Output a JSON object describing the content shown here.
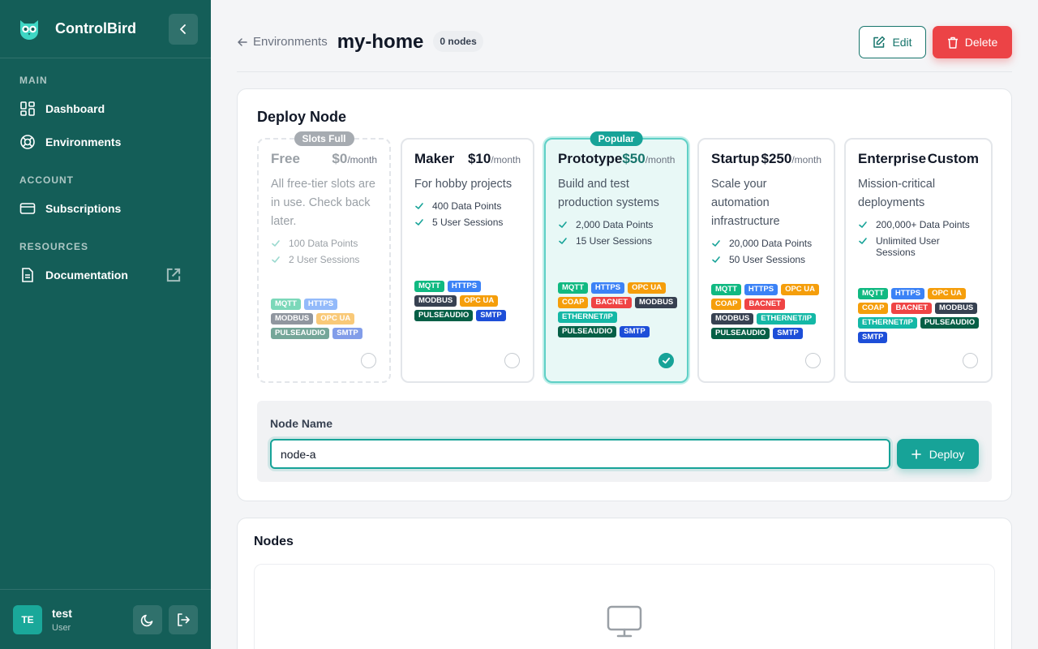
{
  "app": {
    "name": "ControlBird"
  },
  "sidebar": {
    "sections": [
      {
        "heading": "MAIN",
        "items": [
          {
            "label": "Dashboard",
            "icon": "dashboard-icon"
          },
          {
            "label": "Environments",
            "icon": "lifebuoy-icon"
          }
        ]
      },
      {
        "heading": "ACCOUNT",
        "items": [
          {
            "label": "Subscriptions",
            "icon": "credit-card-icon"
          }
        ]
      },
      {
        "heading": "RESOURCES",
        "items": [
          {
            "label": "Documentation",
            "icon": "document-icon"
          }
        ]
      }
    ],
    "user": {
      "initials": "TE",
      "name": "test",
      "role": "User"
    }
  },
  "header": {
    "back_label": "Environments",
    "title": "my-home",
    "node_count": "0 nodes",
    "edit_label": "Edit",
    "delete_label": "Delete"
  },
  "deploy": {
    "title": "Deploy Node",
    "plans": [
      {
        "name": "Free",
        "price": "$0",
        "period": "/month",
        "desc": "All free-tier slots are in use. Check back later.",
        "features": [
          "100 Data Points",
          "2 User Sessions"
        ],
        "badge": "Slots Full",
        "state": "disabled",
        "tags": [
          {
            "t": "MQTT",
            "c": "#10b981"
          },
          {
            "t": "HTTPS",
            "c": "#3b82f6"
          },
          {
            "t": "MODBUS",
            "c": "#374151"
          },
          {
            "t": "OPC UA",
            "c": "#f59e0b"
          },
          {
            "t": "PULSEAUDIO",
            "c": "#065f46"
          },
          {
            "t": "SMTP",
            "c": "#1d4ed8"
          }
        ]
      },
      {
        "name": "Maker",
        "price": "$10",
        "period": "/month",
        "desc": "For hobby projects",
        "features": [
          "400 Data Points",
          "5 User Sessions"
        ],
        "badge": "",
        "state": "normal",
        "tags": [
          {
            "t": "MQTT",
            "c": "#10b981"
          },
          {
            "t": "HTTPS",
            "c": "#3b82f6"
          },
          {
            "t": "MODBUS",
            "c": "#374151"
          },
          {
            "t": "OPC UA",
            "c": "#f59e0b"
          },
          {
            "t": "PULSEAUDIO",
            "c": "#065f46"
          },
          {
            "t": "SMTP",
            "c": "#1d4ed8"
          }
        ]
      },
      {
        "name": "Prototype",
        "price": "$50",
        "period": "/month",
        "desc": "Build and test production systems",
        "features": [
          "2,000 Data Points",
          "15 User Sessions"
        ],
        "badge": "Popular",
        "state": "selected",
        "tags": [
          {
            "t": "MQTT",
            "c": "#10b981"
          },
          {
            "t": "HTTPS",
            "c": "#3b82f6"
          },
          {
            "t": "OPC UA",
            "c": "#f59e0b"
          },
          {
            "t": "COAP",
            "c": "#f59e0b"
          },
          {
            "t": "BACNET",
            "c": "#ef4444"
          },
          {
            "t": "MODBUS",
            "c": "#374151"
          },
          {
            "t": "ETHERNET/IP",
            "c": "#14b8a6"
          },
          {
            "t": "PULSEAUDIO",
            "c": "#065f46"
          },
          {
            "t": "SMTP",
            "c": "#1d4ed8"
          }
        ]
      },
      {
        "name": "Startup",
        "price": "$250",
        "period": "/month",
        "desc": "Scale your automation infrastructure",
        "features": [
          "20,000 Data Points",
          "50 User Sessions"
        ],
        "badge": "",
        "state": "normal",
        "tags": [
          {
            "t": "MQTT",
            "c": "#10b981"
          },
          {
            "t": "HTTPS",
            "c": "#3b82f6"
          },
          {
            "t": "OPC UA",
            "c": "#f59e0b"
          },
          {
            "t": "COAP",
            "c": "#f59e0b"
          },
          {
            "t": "BACNET",
            "c": "#ef4444"
          },
          {
            "t": "MODBUS",
            "c": "#374151"
          },
          {
            "t": "ETHERNET/IP",
            "c": "#14b8a6"
          },
          {
            "t": "PULSEAUDIO",
            "c": "#065f46"
          },
          {
            "t": "SMTP",
            "c": "#1d4ed8"
          }
        ]
      },
      {
        "name": "Enterprise",
        "price": "Custom",
        "period": "",
        "desc": "Mission-critical deployments",
        "features": [
          "200,000+ Data Points",
          "Unlimited User Sessions"
        ],
        "badge": "",
        "state": "normal",
        "tags": [
          {
            "t": "MQTT",
            "c": "#10b981"
          },
          {
            "t": "HTTPS",
            "c": "#3b82f6"
          },
          {
            "t": "OPC UA",
            "c": "#f59e0b"
          },
          {
            "t": "COAP",
            "c": "#f59e0b"
          },
          {
            "t": "BACNET",
            "c": "#ef4444"
          },
          {
            "t": "MODBUS",
            "c": "#374151"
          },
          {
            "t": "ETHERNET/IP",
            "c": "#14b8a6"
          },
          {
            "t": "PULSEAUDIO",
            "c": "#065f46"
          },
          {
            "t": "SMTP",
            "c": "#1d4ed8"
          }
        ]
      }
    ],
    "node_name_label": "Node Name",
    "node_name_value": "node-a",
    "deploy_label": "Deploy"
  },
  "nodes": {
    "title": "Nodes",
    "empty_icon": "monitor-icon"
  },
  "colors": {
    "sidebar": "#145e58",
    "accent": "#17a398",
    "danger": "#ec4346",
    "badge_full": "#a6abb1",
    "badge_popular": "#17a398"
  }
}
